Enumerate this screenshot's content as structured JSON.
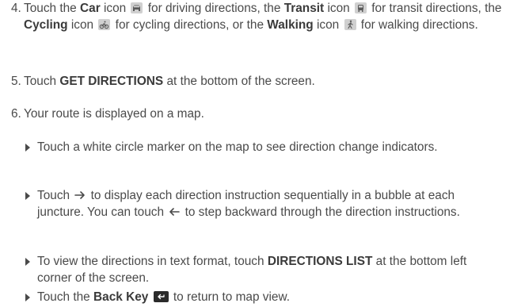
{
  "steps": [
    {
      "number": "4.",
      "t1": "Touch the ",
      "car": "Car",
      "t2": " icon ",
      "t3": " for driving directions, the ",
      "transit": "Transit",
      "t4": " icon ",
      "t5": " for transit directions, the ",
      "cycling": "Cycling",
      "t6": " icon ",
      "t7": " for cycling directions, or the ",
      "walking": "Walking",
      "t8": " icon ",
      "t9": " for walking directions."
    },
    {
      "number": "5.",
      "t1": "Touch ",
      "get_directions": "GET DIRECTIONS",
      "t2": " at the bottom of the screen."
    },
    {
      "number": "6.",
      "t1": "Your route is displayed on a map."
    }
  ],
  "bullets": [
    {
      "t1": "Touch a white circle marker on the map to see direction change indicators."
    },
    {
      "t1": "Touch ",
      "t2": " to display each direction instruction sequentially in a bubble at each juncture. You can touch ",
      "t3": " to step backward through the direction instructions."
    },
    {
      "t1": "To view the directions in text format, touch ",
      "directions_list": "DIRECTIONS LIST",
      "t2": " at the bottom left corner of the screen."
    },
    {
      "t1": "Touch the ",
      "back_key": "Back Key",
      "t2": " ",
      "t3": " to return to map view."
    }
  ],
  "icons": {
    "car": "car-icon",
    "transit": "transit-icon",
    "cycling": "cycling-icon",
    "walking": "walking-icon",
    "forward": "arrow-right-icon",
    "backward": "arrow-left-icon",
    "back_key": "back-key-icon"
  },
  "colors": {
    "text": "#4a4a4a",
    "icon_bg": "#d0d0d0",
    "back_key_bg": "#2b2b2b"
  }
}
